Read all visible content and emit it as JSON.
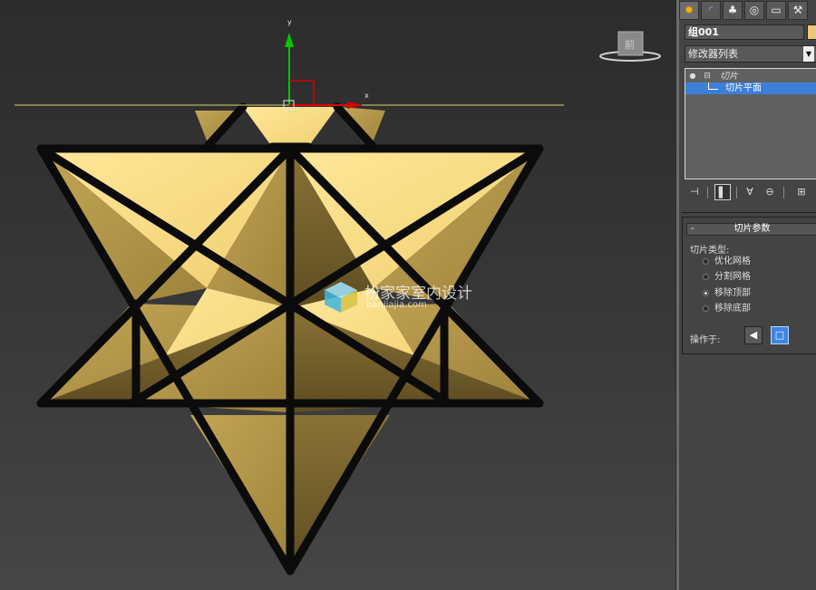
{
  "viewport": {
    "axis_y_label": "y",
    "axis_x_label": "x",
    "viewcube_label": "前",
    "watermark": {
      "title": "扮家家室内设计",
      "url": "banjiajia.com"
    },
    "colors": {
      "star_face_light": "#f9df86",
      "star_face_mid": "#b89a49",
      "star_face_dark": "#7a6530",
      "edge": "#0b0b0b",
      "slice_plane": "#d9cf6a",
      "gizmo_y": "#00c800",
      "gizmo_x": "#e00000"
    }
  },
  "panel": {
    "tabs": [
      {
        "icon": "sun-create-icon",
        "glyph": "✹"
      },
      {
        "icon": "modify-curve-icon",
        "glyph": "◜"
      },
      {
        "icon": "hierarchy-icon",
        "glyph": "♣"
      },
      {
        "icon": "motion-icon",
        "glyph": "◎"
      },
      {
        "icon": "display-monitor-icon",
        "glyph": "▭"
      },
      {
        "icon": "utilities-hammer-icon",
        "glyph": "⚒"
      }
    ],
    "object_name": "组001",
    "object_color": "#e8c878",
    "modifier_list": "修改器列表",
    "stack": [
      {
        "label": "切片",
        "expanded_glyph": "⊟",
        "light_glyph": "💡"
      },
      {
        "label": "切片平面"
      }
    ],
    "toolbar": [
      {
        "icon": "pin-stack-icon",
        "glyph": "⊣"
      },
      {
        "icon": "show-end-result-icon",
        "glyph": "▌"
      },
      {
        "icon": "make-unique-icon",
        "glyph": "∀"
      },
      {
        "icon": "remove-modifier-icon",
        "glyph": "⊖"
      },
      {
        "icon": "configure-sets-icon",
        "glyph": "⊞"
      }
    ],
    "rollout": {
      "minus": "-",
      "title": "切片参数",
      "slice_type_label": "切片类型:",
      "options": [
        {
          "label": "优化网格",
          "checked": false
        },
        {
          "label": "分割网格",
          "checked": false
        },
        {
          "label": "移除顶部",
          "checked": true
        },
        {
          "label": "移除底部",
          "checked": false
        }
      ],
      "operate_on_label": "操作于:",
      "operate_buttons": [
        {
          "icon": "face-select-icon",
          "glyph": "◀",
          "active": false
        },
        {
          "icon": "polygon-select-icon",
          "glyph": "□",
          "active": true
        }
      ]
    }
  }
}
